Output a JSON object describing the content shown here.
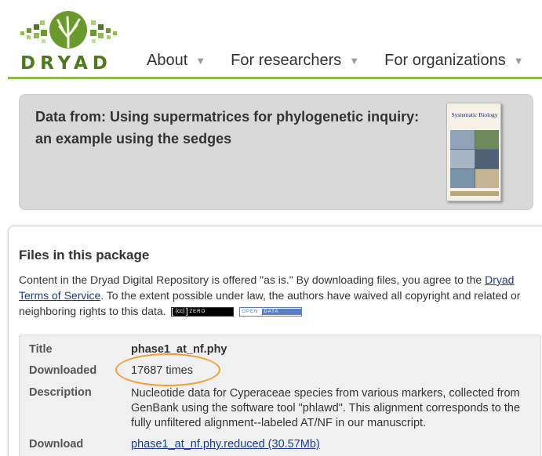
{
  "brand": {
    "name": "DRYAD",
    "green": "#4e7a1e",
    "accent": "#8bbd4a"
  },
  "nav": [
    {
      "label": "About"
    },
    {
      "label": "For researchers"
    },
    {
      "label": "For organizations"
    }
  ],
  "dataset": {
    "title": "Data from: Using supermatrices for phylogenetic inquiry: an example using the sedges",
    "journal_cover_title": "Systematic Biology"
  },
  "files": {
    "heading": "Files in this package",
    "note_prefix": "Content in the Dryad Digital Repository is offered \"as is.\" By downloading files, you agree to the ",
    "note_link": "Dryad Terms of Service",
    "note_suffix": ". To the extent possible under law, the authors have waived all copyright and related or neighboring rights to this data.",
    "badge_cc": "ZERO",
    "badge_open": "OPEN",
    "badge_data": "DATA",
    "file": {
      "title_label": "Title",
      "title_value": "phase1_at_nf.phy",
      "downloaded_label": "Downloaded",
      "downloaded_value": "17687 times",
      "description_label": "Description",
      "description_value": "Nucleotide data for Cyperaceae species from various markers, collected from GenBank using the software tool \"phlawd\". This alignment corresponds to the fully unfiltered alignment--labeled AT/NF in our manuscript.",
      "download_label": "Download",
      "download_link": "phase1_at_nf.phy.reduced (30.57Mb)"
    }
  }
}
